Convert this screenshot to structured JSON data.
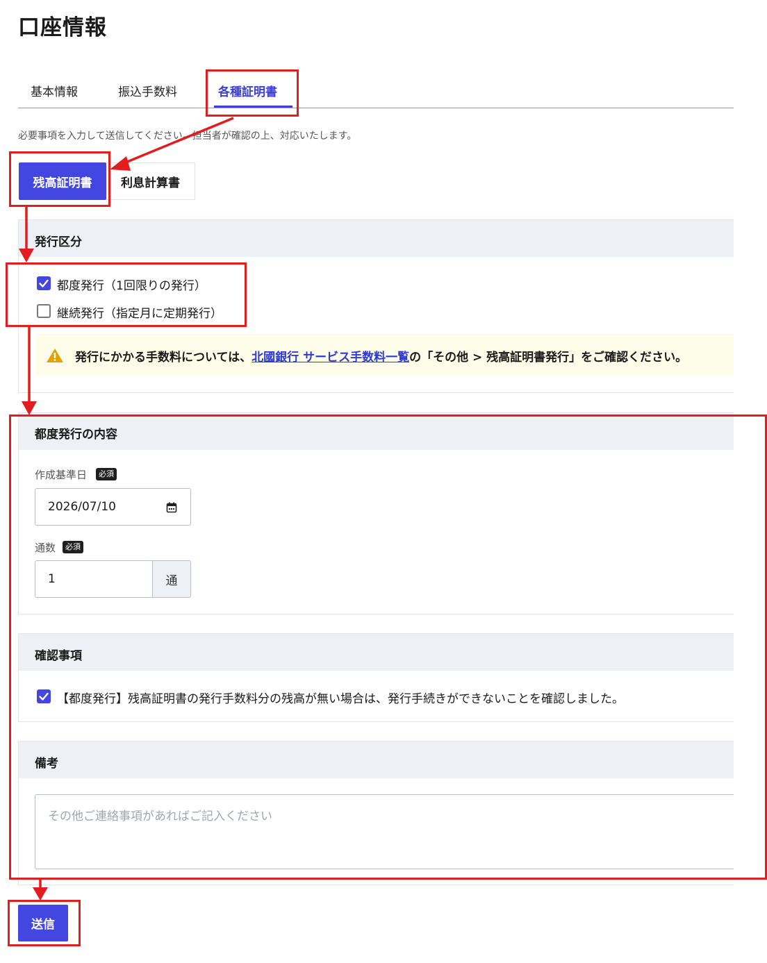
{
  "page_title": "口座情報",
  "tabs": [
    {
      "label": "基本情報",
      "active": false
    },
    {
      "label": "振込手数料",
      "active": false
    },
    {
      "label": "各種証明書",
      "active": true
    }
  ],
  "instruction": "必要事項を入力して送信してください。担当者が確認の上、対応いたします。",
  "doc_types": [
    {
      "label": "残高証明書",
      "active": true
    },
    {
      "label": "利息計算書",
      "active": false
    }
  ],
  "issue_type": {
    "title": "発行区分",
    "options": [
      {
        "label": "都度発行（1回限りの発行）",
        "checked": true
      },
      {
        "label": "継続発行（指定月に定期発行）",
        "checked": false
      }
    ],
    "notice": {
      "before": "発行にかかる手数料については、",
      "link": "北國銀行 サービス手数料一覧",
      "after": "の「その他 > 残高証明書発行」をご確認ください。"
    }
  },
  "one_time": {
    "title": "都度発行の内容",
    "date_label": "作成基準日",
    "date_value": "2026/07/10",
    "copies_label": "通数",
    "copies_value": "1",
    "copies_unit": "通",
    "required_badge": "必須"
  },
  "confirm": {
    "title": "確認事項",
    "text": "【都度発行】残高証明書の発行手数料分の残高が無い場合は、発行手続きができないことを確認しました。",
    "checked": true
  },
  "remarks": {
    "title": "備考",
    "placeholder": "その他ご連絡事項があればご記入ください"
  },
  "submit_label": "送信",
  "colors": {
    "accent": "#4346e0",
    "annotation": "#e21d1d",
    "section_header": "#edf1f5",
    "notice_bg": "#fefde9"
  }
}
